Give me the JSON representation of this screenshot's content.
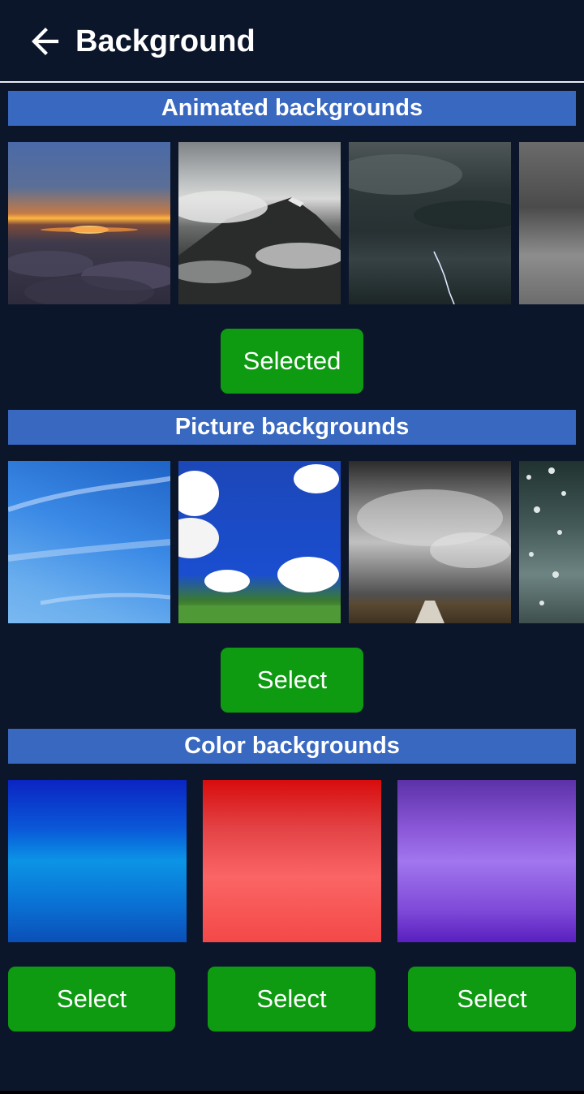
{
  "header": {
    "title": "Background",
    "back_icon": "arrow-left-icon"
  },
  "sections": {
    "animated": {
      "title": "Animated backgrounds",
      "thumbnails": [
        "sunset-above-clouds",
        "misty-mountain",
        "stormy-sea-lightning",
        "grey-water"
      ],
      "button_label": "Selected"
    },
    "picture": {
      "title": "Picture backgrounds",
      "thumbnails": [
        "blue-sky-wispy-clouds",
        "white-clouds-grass",
        "storm-clouds-road",
        "rain-drops-glass"
      ],
      "button_label": "Select"
    },
    "color": {
      "title": "Color backgrounds",
      "swatches": [
        {
          "name": "blue-gradient",
          "colors": [
            "#0b24c2",
            "#0b94e6",
            "#0a4fb8"
          ],
          "button_label": "Select"
        },
        {
          "name": "red-gradient",
          "colors": [
            "#d80c0c",
            "#fb6565",
            "#f44848"
          ],
          "button_label": "Select"
        },
        {
          "name": "purple-gradient",
          "colors": [
            "#5c32a8",
            "#a176ee",
            "#5a1fc0"
          ],
          "button_label": "Select"
        }
      ]
    }
  },
  "colors": {
    "page_background": "#0c162b",
    "section_header": "#3868c0",
    "button": "#0e9a11"
  }
}
